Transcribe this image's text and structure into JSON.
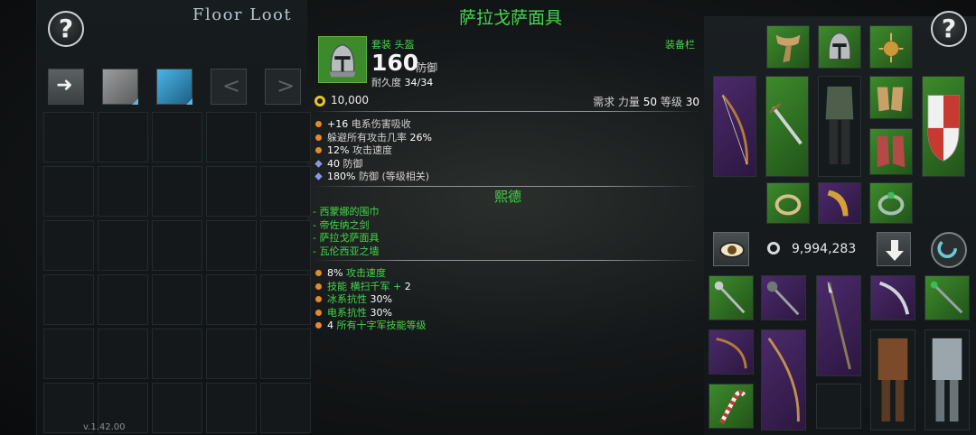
{
  "left_panel": {
    "title": "Floor Loot",
    "help_symbol": "?",
    "nav_prev": "<",
    "nav_next": ">",
    "version": "v.1.42.00"
  },
  "tooltip": {
    "item_name": "萨拉戈萨面具",
    "type_line": "套装 头盔",
    "slot_label": "装备栏",
    "defense_value": "160",
    "defense_label": "防御",
    "durability_label": "耐久度",
    "durability": "34/34",
    "price": "10,000",
    "requirements": {
      "label": "需求",
      "strength_label": "力量",
      "strength": "50",
      "level_label": "等级",
      "level": "30"
    },
    "affixes": [
      {
        "bullet": "orange",
        "pre": "+16",
        "text": " 电系伤害吸收"
      },
      {
        "bullet": "orange",
        "pre": "",
        "text": "躲避所有攻击几率 ",
        "post": "26%"
      },
      {
        "bullet": "orange",
        "pre": "12%",
        "text": " 攻击速度"
      },
      {
        "bullet": "diamond",
        "pre": "40",
        "text": " 防御"
      },
      {
        "bullet": "diamond",
        "pre": "180%",
        "text": " 防御 (等级相关)"
      }
    ],
    "set_name": "熙德",
    "set_items": [
      "- 西蒙娜的围巾",
      "- 帝佐纳之剑",
      "- 萨拉戈萨面具",
      "- 瓦伦西亚之墙"
    ],
    "set_bonuses": [
      {
        "pre": "8%",
        "text": " 攻击速度"
      },
      {
        "pre": "",
        "text": "技能 横扫千军 + ",
        "post": "2"
      },
      {
        "pre": "",
        "text": "冰系抗性 ",
        "post": "30%"
      },
      {
        "pre": "",
        "text": "电系抗性 ",
        "post": "30%"
      },
      {
        "pre": "4",
        "text": " 所有十字军技能等级"
      }
    ]
  },
  "right_panel": {
    "help_symbol": "?",
    "gold_total": "9,994,283"
  },
  "colors": {
    "set_green": "#43d64a",
    "orange_bullet": "#e58a2b",
    "diamond_bullet": "#8d96e6",
    "slot_green": "#3d8a2b",
    "slot_purple": "#4b2a6b"
  }
}
